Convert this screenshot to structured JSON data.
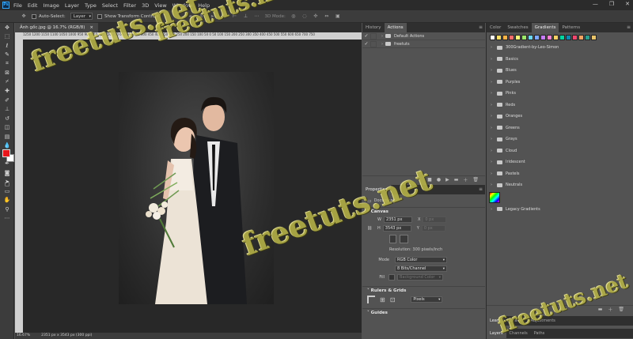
{
  "menubar": {
    "logo": "Ps",
    "items": [
      "File",
      "Edit",
      "Image",
      "Layer",
      "Type",
      "Select",
      "Filter",
      "3D",
      "View",
      "Window",
      "Help"
    ],
    "window_controls": [
      "—",
      "❐",
      "✕"
    ]
  },
  "options_bar": {
    "auto_select_label": "Auto-Select:",
    "auto_select_value": "Layer",
    "transform_controls_label": "Show Transform Controls",
    "mode_3d_label": "3D Mode:"
  },
  "document": {
    "tab_title": "Ảnh gốc.jpg @ 16.7% (RGB/8)",
    "tab_close": "×",
    "ruler_marks": "1250  1200  1150  1100  1050  1000  950  900  850  800  750  700  650  600  550  500  450  400  350  300  250  200  150  100  50  0  50  100  150  200  250  300  350  400  450  500  550  600  650  700  750",
    "zoom": "16.67%",
    "doc_info": "2351 px x 3543 px (300 ppi)"
  },
  "watermark": {
    "text": "freetuts.net"
  },
  "actions_panel": {
    "tabs": [
      "History",
      "Actions"
    ],
    "active_tab": "Actions",
    "rows": [
      {
        "label": "Default Actions"
      },
      {
        "label": "freetuts"
      }
    ],
    "toolbar_icons": [
      "stop-icon",
      "record-icon",
      "play-icon",
      "new-set-icon",
      "new-action-icon",
      "delete-icon"
    ]
  },
  "properties_panel": {
    "tab": "Properties",
    "doc_label": "Document",
    "canvas_title": "Canvas",
    "w_label": "W",
    "w_value": "2351 px",
    "h_label": "H",
    "h_value": "3543 px",
    "x_label": "X",
    "x_value": "0 px",
    "y_label": "Y",
    "y_value": "0 px",
    "resolution": "Resolution: 300 pixels/inch",
    "mode_label": "Mode",
    "mode_value": "RGB Color",
    "bit_depth": "8 Bits/Channel",
    "fill_label": "Fill",
    "fill_value": "Background Color",
    "rulers_title": "Rulers & Grids",
    "units_value": "Pixels",
    "guides_title": "Guides"
  },
  "gradients_panel": {
    "tabs": [
      "Color",
      "Swatches",
      "Gradients",
      "Patterns"
    ],
    "active_tab": "Gradients",
    "swatch_colors": [
      "#ffffff",
      "#ffe066",
      "#ffb347",
      "#ff6b6b",
      "#f8f87a",
      "#9ee86b",
      "#6bd6f0",
      "#7fa6ff",
      "#c77dff",
      "#ff7fd1",
      "#ffd166",
      "#06d6a0",
      "#118ab2",
      "#ef476f",
      "#f4a261",
      "#2a9d8f",
      "#e9c46a"
    ],
    "groups": [
      "300Gradient-by-Leo-Simon",
      "Basics",
      "Blues",
      "Purples",
      "Pinks",
      "Reds",
      "Oranges",
      "Greens",
      "Grays",
      "Cloud",
      "Iridescent",
      "Pastels",
      "Neutrals"
    ],
    "legacy_label": "Legacy Gradients",
    "lower_tabs": [
      "Learn",
      "Libraries",
      "Adjustments"
    ],
    "bottom_tabs": [
      "Layers",
      "Channels",
      "Paths"
    ]
  }
}
